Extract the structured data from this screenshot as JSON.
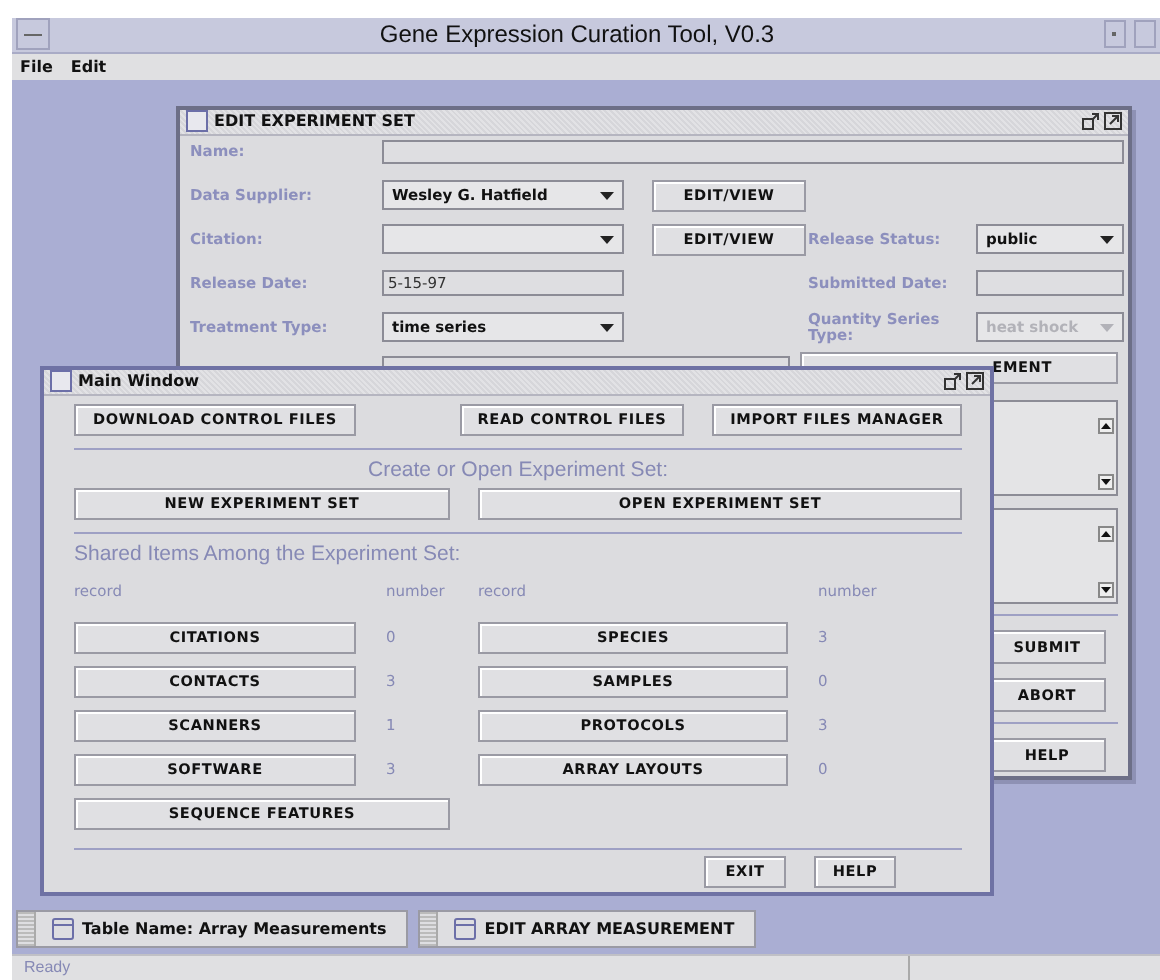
{
  "window": {
    "title": "Gene Expression Curation Tool, V0.3"
  },
  "menu": [
    "File",
    "Edit"
  ],
  "edit_window": {
    "title": "EDIT EXPERIMENT SET",
    "rows": [
      {
        "label": "Name:",
        "control": {
          "kind": "text"
        }
      },
      {
        "label": "Data Supplier:",
        "control": {
          "kind": "dropdown",
          "value": "Wesley G. Hatfield",
          "disabled": false
        },
        "button": "EDIT/VIEW"
      },
      {
        "label": "Citation:",
        "control": {
          "kind": "dropdown",
          "disabled": false
        },
        "button": "EDIT/VIEW",
        "side_label": "Release Status:",
        "side_control": {
          "kind": "dropdown",
          "value": "public",
          "disabled": false
        }
      },
      {
        "label": "Release Date:",
        "control": {
          "kind": "text",
          "value": "5-15-97"
        },
        "side_label": "Submitted Date:",
        "side_control": {
          "kind": "text"
        }
      },
      {
        "label": "Treatment Type:",
        "control": {
          "kind": "dropdown",
          "value": "time series",
          "disabled": false
        },
        "side_label": "Quantity Series Type:",
        "side_control": {
          "kind": "dropdown",
          "value": "heat shock",
          "disabled": true
        }
      }
    ],
    "partial_button": "EMENT",
    "button_groups": [
      [
        "SUBMIT",
        "ABORT"
      ],
      [
        "HELP"
      ]
    ]
  },
  "main_window": {
    "title": "Main Window",
    "top_buttons": [
      "DOWNLOAD CONTROL FILES",
      "READ CONTROL FILES",
      "IMPORT FILES MANAGER"
    ],
    "create_heading": "Create or Open Experiment Set:",
    "create_buttons": [
      "NEW EXPERIMENT SET",
      "OPEN EXPERIMENT SET"
    ],
    "shared_heading": "Shared Items Among the Experiment Set:",
    "columns": [
      "record",
      "number",
      "record",
      "number"
    ],
    "records": [
      [
        {
          "label": "CITATIONS",
          "number": "0"
        },
        {
          "label": "SPECIES",
          "number": "3"
        }
      ],
      [
        {
          "label": "CONTACTS",
          "number": "3"
        },
        {
          "label": "SAMPLES",
          "number": "0"
        }
      ],
      [
        {
          "label": "SCANNERS",
          "number": "1"
        },
        {
          "label": "PROTOCOLS",
          "number": "3"
        }
      ],
      [
        {
          "label": "SOFTWARE",
          "number": "3"
        },
        {
          "label": "ARRAY LAYOUTS",
          "number": "0"
        }
      ],
      [
        {
          "label": "SEQUENCE FEATURES"
        }
      ]
    ],
    "footer_buttons": [
      "EXIT",
      "HELP"
    ]
  },
  "taskbar": [
    {
      "label": "Table Name: Array Measurements"
    },
    {
      "label": "EDIT ARRAY MEASUREMENT"
    }
  ],
  "status_bar": "Ready"
}
